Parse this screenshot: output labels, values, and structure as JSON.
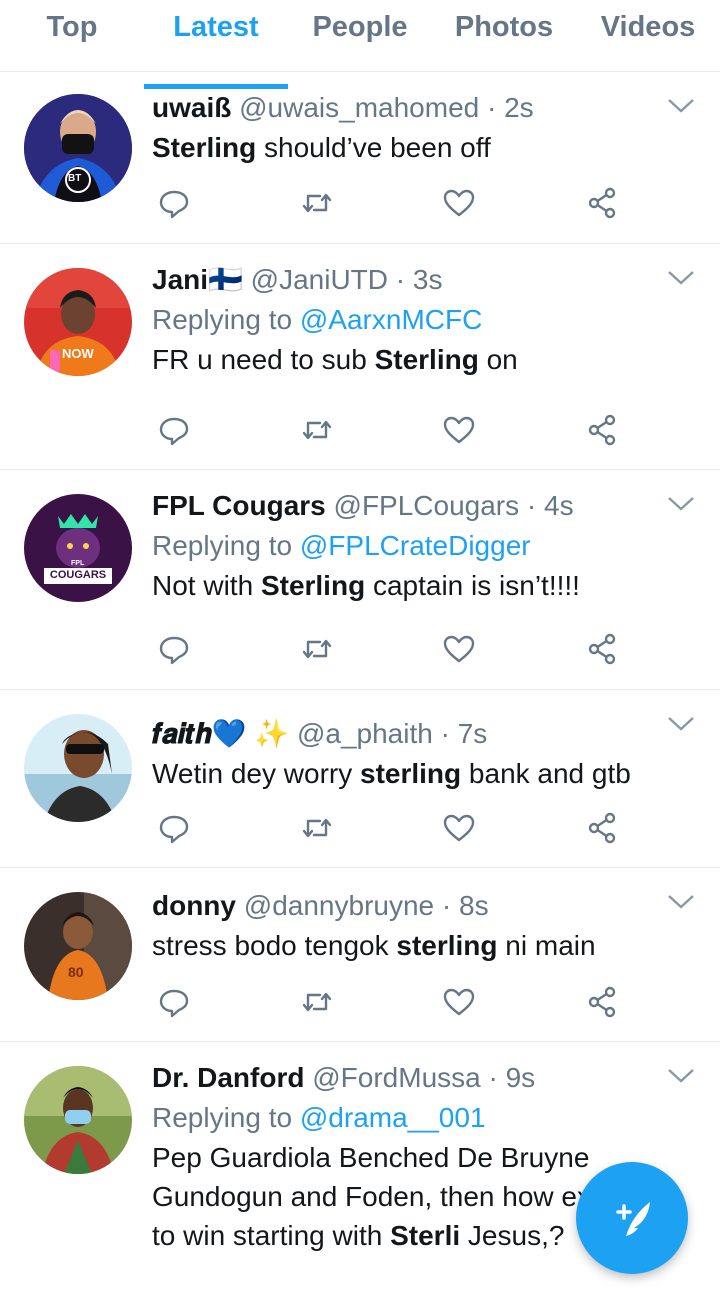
{
  "tabs": [
    "Top",
    "Latest",
    "People",
    "Photos",
    "Videos"
  ],
  "active_tab": "Latest",
  "tweets": [
    {
      "name": "uwaiß",
      "handle": "@uwais_mahomed",
      "time": "· 2s",
      "reply_prefix": "",
      "reply_to": "",
      "text_parts": [
        "",
        "Sterling",
        " should’ve been off"
      ]
    },
    {
      "name": "Jani🇫🇮",
      "handle": "@JaniUTD",
      "time": "· 3s",
      "reply_prefix": "Replying to ",
      "reply_to": "@AarxnMCFC",
      "text_parts": [
        "FR u need to sub ",
        "Sterling",
        " on"
      ]
    },
    {
      "name": "FPL Cougars",
      "handle": "@FPLCougars",
      "time": "· 4s",
      "reply_prefix": "Replying to ",
      "reply_to": "@FPLCrateDigger",
      "text_parts": [
        "Not with ",
        "Sterling",
        " captain is isn’t!!!!"
      ]
    },
    {
      "name": "𝒇𝒂𝒊𝒕𝒉💙 ✨",
      "handle": "@a_phaith",
      "time": "· 7s",
      "reply_prefix": "",
      "reply_to": "",
      "text_parts": [
        "Wetin dey worry ",
        "sterling",
        " bank and gtb"
      ]
    },
    {
      "name": "donny",
      "handle": "@dannybruyne",
      "time": "· 8s",
      "reply_prefix": "",
      "reply_to": "",
      "text_parts": [
        "stress bodo tengok ",
        "sterling",
        " ni main"
      ]
    },
    {
      "name": "Dr. Danford",
      "handle": "@FordMussa",
      "time": "· 9s",
      "reply_prefix": "Replying to ",
      "reply_to": "@drama__001",
      "text_parts": [
        "Pep Guardiola Benched De Bruyne Gundogun and Foden, then how expect to win starting with ",
        "Sterli",
        " Jesus,?"
      ]
    }
  ],
  "avatar_badges": {
    "bt": "BT",
    "fpl_small": "FPL",
    "fpl_big": "COUGARS",
    "shirt": "NOW",
    "shirt_number": "80"
  },
  "colors": {
    "accent": "#1da1f2",
    "text": "#14171a",
    "secondary": "#657786",
    "divider": "#e6ecf0"
  },
  "icons": [
    "reply-icon",
    "retweet-icon",
    "like-icon",
    "share-icon",
    "chevron-down-icon",
    "compose-tweet-icon"
  ]
}
